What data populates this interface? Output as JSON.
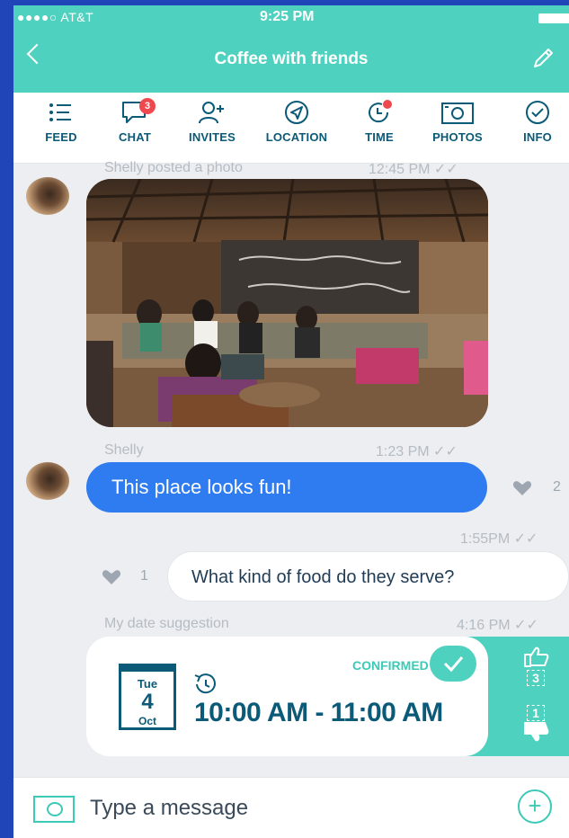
{
  "status_bar": {
    "carrier": "●●●●○ AT&T",
    "time": "9:25 PM"
  },
  "header": {
    "title": "Coffee with friends"
  },
  "tabs": [
    {
      "label": "FEED",
      "icon": "feed-icon"
    },
    {
      "label": "CHAT",
      "icon": "chat-icon",
      "badge": "3"
    },
    {
      "label": "INVITES",
      "icon": "add-person-icon"
    },
    {
      "label": "LOCATION",
      "icon": "location-arrow-icon"
    },
    {
      "label": "TIME",
      "icon": "time-icon"
    },
    {
      "label": "PHOTOS",
      "icon": "camera-icon"
    },
    {
      "label": "INFO",
      "icon": "check-circle-icon"
    }
  ],
  "messages": {
    "photo_post": {
      "caption": "Shelly posted a photo",
      "time": "12:45 PM ✓✓"
    },
    "shelly_msg": {
      "sender": "Shelly",
      "time": "1:23 PM ✓✓",
      "text": "This place looks fun!",
      "likes": "2"
    },
    "my_msg": {
      "time": "1:55PM ✓✓",
      "text": "What kind of food do they serve?",
      "likes": "1"
    },
    "suggestion": {
      "caption": "My date suggestion",
      "time": "4:16 PM ✓✓",
      "status": "CONFIRMED",
      "weekday": "Tue",
      "day": "4",
      "month": "Oct",
      "time_range": "10:00 AM - 11:00 AM",
      "upvotes": "3",
      "downvotes": "1"
    }
  },
  "composer": {
    "placeholder": "Type a message"
  },
  "colors": {
    "accent": "#4fd1bf",
    "bubble": "#2f7bf0",
    "ink": "#0a5a78"
  }
}
